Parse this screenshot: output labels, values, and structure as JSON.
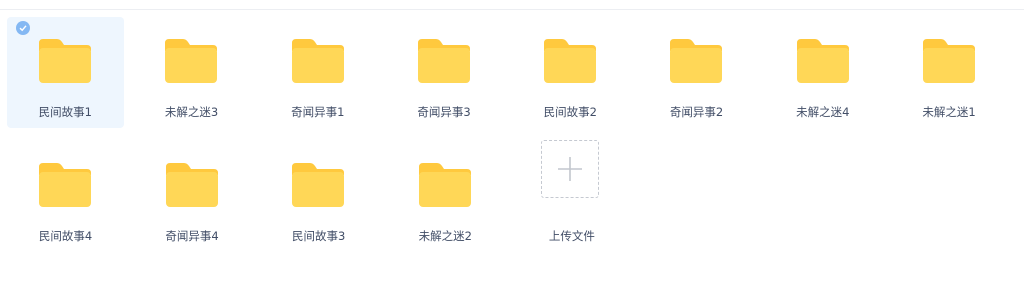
{
  "files": {
    "row1": [
      {
        "label": "民间故事1",
        "icon": "folder-icon",
        "selected": true
      },
      {
        "label": "未解之迷3",
        "icon": "folder-icon"
      },
      {
        "label": "奇闻异事1",
        "icon": "folder-icon"
      },
      {
        "label": "奇闻异事3",
        "icon": "folder-icon"
      },
      {
        "label": "民间故事2",
        "icon": "folder-icon"
      },
      {
        "label": "奇闻异事2",
        "icon": "folder-icon"
      },
      {
        "label": "未解之迷4",
        "icon": "folder-icon"
      },
      {
        "label": "未解之迷1",
        "icon": "folder-icon"
      }
    ],
    "row2": [
      {
        "label": "民间故事4",
        "icon": "folder-icon"
      },
      {
        "label": "奇闻异事4",
        "icon": "folder-icon"
      },
      {
        "label": "民间故事3",
        "icon": "folder-icon"
      },
      {
        "label": "未解之迷2",
        "icon": "folder-icon"
      }
    ]
  },
  "upload": {
    "label": "上传文件",
    "icon": "plus-icon"
  },
  "colors": {
    "folder_body": "#ffd757",
    "folder_tab": "#ffc93e",
    "selected_bg": "#eef6fe",
    "check": "#84b8f3",
    "text": "#424e67"
  }
}
